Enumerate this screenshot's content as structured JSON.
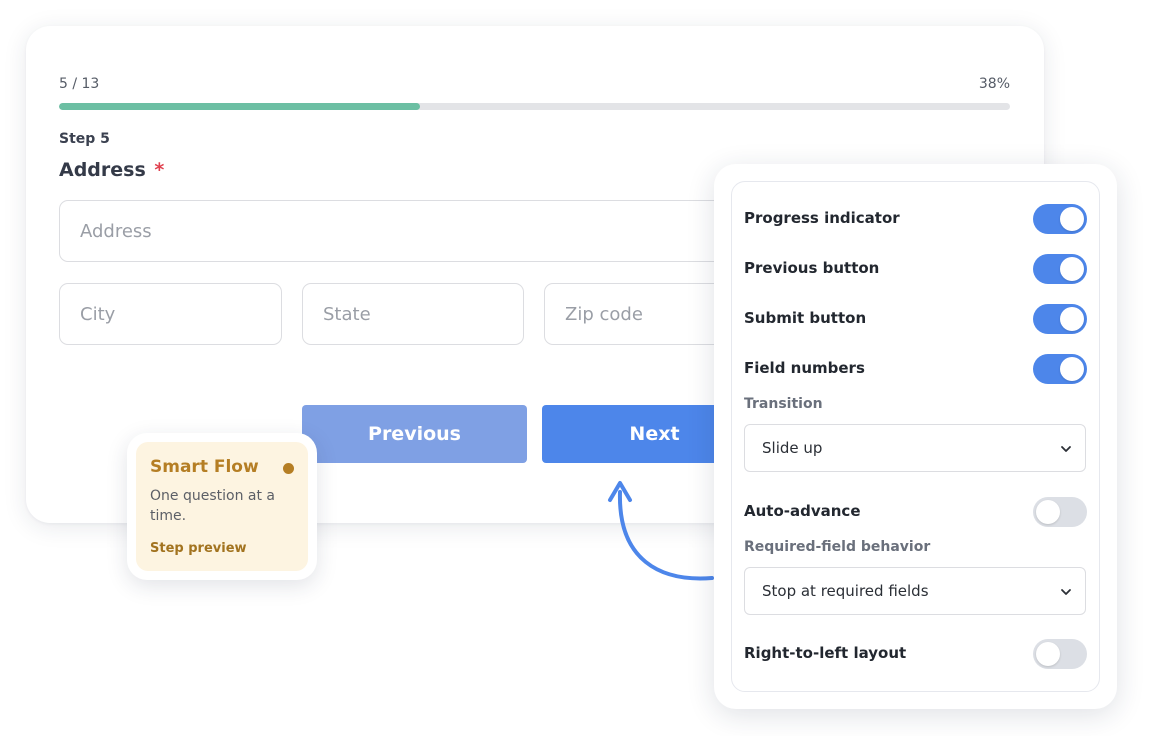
{
  "form": {
    "progress_count": "5 / 13",
    "progress_percent_label": "38%",
    "progress_fraction": 0.38,
    "step_label": "Step 5",
    "field_title": "Address",
    "required_marker": "*",
    "inputs": {
      "address_placeholder": "Address",
      "city_placeholder": "City",
      "state_placeholder": "State",
      "zip_placeholder": "Zip code"
    },
    "previous_label": "Previous",
    "next_label": "Next"
  },
  "smart_flow": {
    "title": "Smart Flow",
    "description": "One question at a time.",
    "link": "Step preview"
  },
  "settings": {
    "progress_indicator": {
      "label": "Progress indicator",
      "on": true
    },
    "previous_button": {
      "label": "Previous button",
      "on": true
    },
    "submit_button": {
      "label": "Submit button",
      "on": true
    },
    "field_numbers": {
      "label": "Field numbers",
      "on": true
    },
    "transition": {
      "label": "Transition",
      "value": "Slide up"
    },
    "auto_advance": {
      "label": "Auto-advance",
      "on": false
    },
    "required_behavior": {
      "label": "Required-field behavior",
      "value": "Stop at required fields"
    },
    "rtl_layout": {
      "label": "Right-to-left layout",
      "on": false
    }
  },
  "colors": {
    "accent": "#4d86ea",
    "progress": "#6cbfa3",
    "smart_flow_bg": "#fdf4e1",
    "smart_flow_text": "#b57e24",
    "required": "#e0414f"
  },
  "icons": {
    "select_chevron": "chevron-down-icon",
    "callout_arrow": "curved-arrow-icon",
    "status_dot": "dot-icon"
  }
}
